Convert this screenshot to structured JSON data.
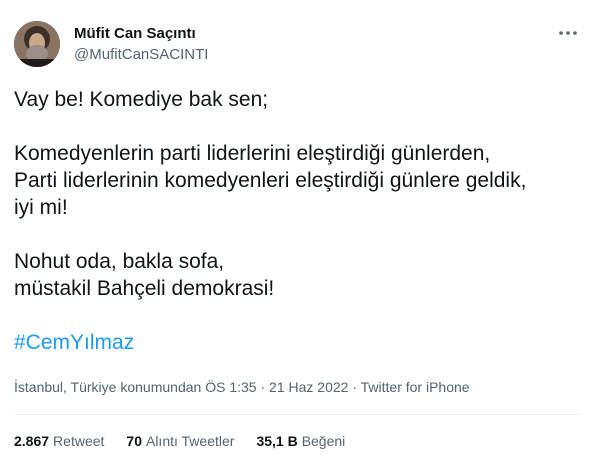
{
  "author": {
    "display_name": "Müfit Can Saçıntı",
    "handle": "@MufitCanSACINTI"
  },
  "tweet": {
    "lines": [
      "Vay be! Komediye bak sen;",
      "Komedyenlerin parti liderlerini eleştirdiği günlerden,",
      "Parti liderlerinin komedyenleri eleştirdiği günlere geldik,",
      "iyi mi!",
      "Nohut oda, bakla sofa,",
      "müstakil Bahçeli demokrasi!"
    ],
    "hashtag": "#CemYılmaz"
  },
  "meta": {
    "location": "İstanbul, Türkiye konumundan",
    "time": "ÖS 1:35",
    "separator": "·",
    "date": "21 Haz 2022",
    "source": "Twitter for iPhone"
  },
  "stats": {
    "retweets_count": "2.867",
    "retweets_label": "Retweet",
    "quotes_count": "70",
    "quotes_label": "Alıntı Tweetler",
    "likes_count": "35,1 B",
    "likes_label": "Beğeni"
  },
  "icons": {
    "more": "more-horizontal-icon"
  },
  "colors": {
    "text_primary": "#0f1419",
    "text_secondary": "#536471",
    "accent": "#1d9bf0",
    "divider": "#eff3f4"
  }
}
